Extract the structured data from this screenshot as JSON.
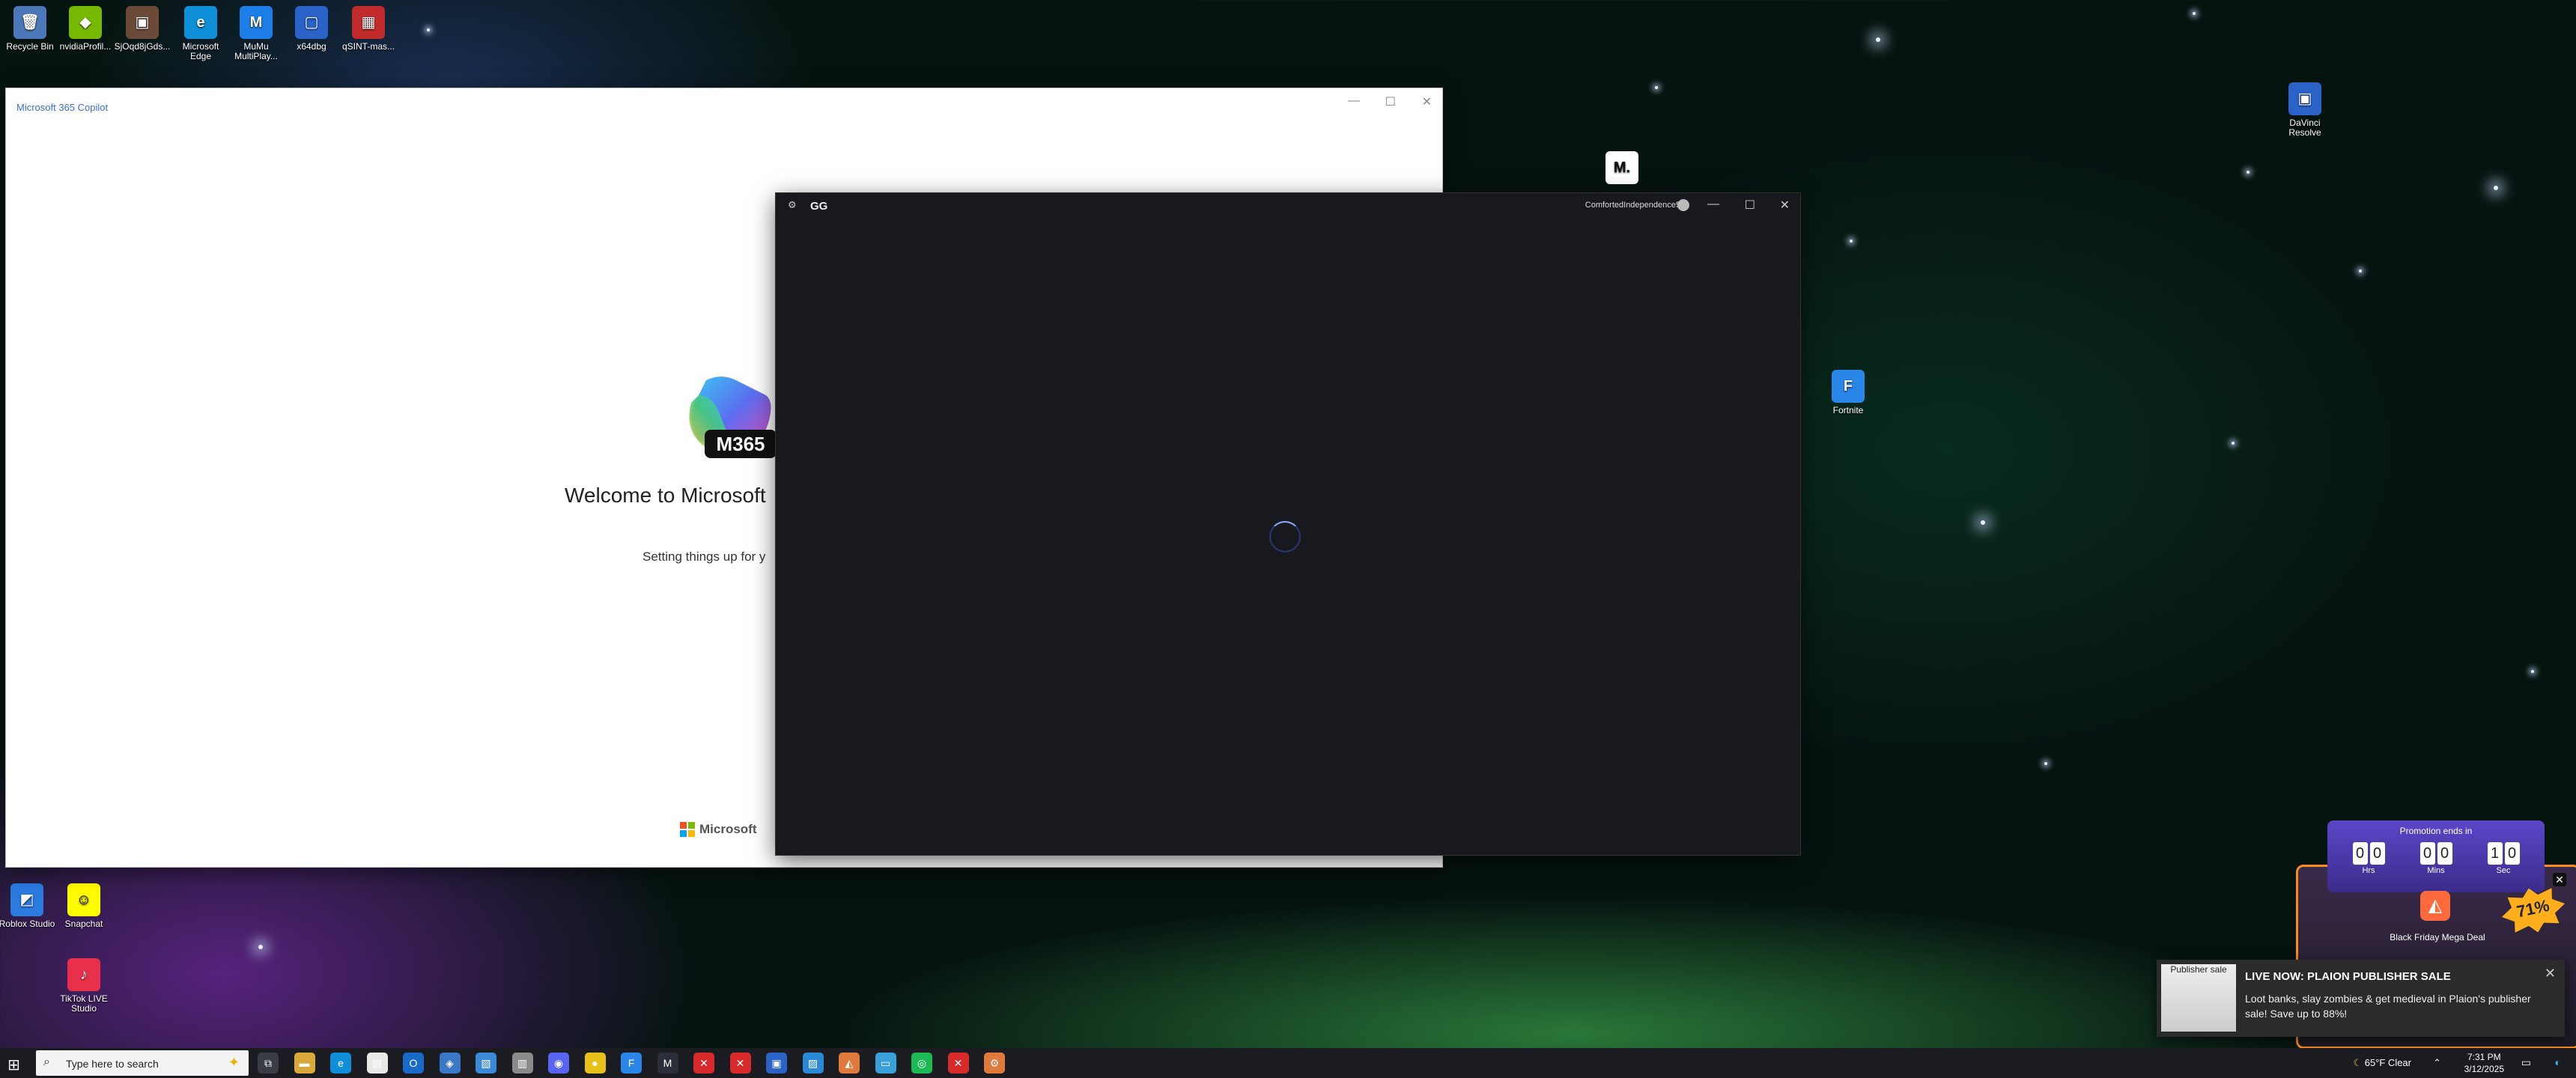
{
  "desktop_icons_top": [
    {
      "name": "recycle-bin-icon",
      "label": "Recycle Bin",
      "glyph": "🗑",
      "color": "#4a78b8"
    },
    {
      "name": "nvidia-icon",
      "label": "nvidiaProfil...",
      "glyph": "◆",
      "color": "#76b900"
    },
    {
      "name": "sjoq-icon",
      "label": "SjOqd8jGds...",
      "glyph": "▣",
      "color": "#6b4a3a"
    },
    {
      "name": "edge-icon",
      "label": "Microsoft Edge",
      "glyph": "e",
      "color": "#0f8fd8"
    },
    {
      "name": "mumu-icon",
      "label": "MuMu MultiPlay...",
      "glyph": "M",
      "color": "#1e7ee8"
    },
    {
      "name": "x64dbg-icon",
      "label": "x64dbg",
      "glyph": "▢",
      "color": "#2a62c8"
    },
    {
      "name": "qsint-icon",
      "label": "qSINT-mas...",
      "glyph": "▦",
      "color": "#c02a2a"
    }
  ],
  "desktop_icons_other": [
    {
      "name": "davinci-icon",
      "label": "DaVinci Resolve",
      "glyph": "▣",
      "color": "#2a62c8"
    },
    {
      "name": "m-app-icon",
      "label": "",
      "glyph": "M.",
      "color": "#ffffff"
    },
    {
      "name": "fortnite-icon",
      "label": "Fortnite",
      "glyph": "F",
      "color": "#2a86e8"
    },
    {
      "name": "roblox-icon",
      "label": "Roblox Studio",
      "glyph": "◩",
      "color": "#2a7ae0"
    },
    {
      "name": "snapchat-icon",
      "label": "Snapchat",
      "glyph": "☺",
      "color": "#fffc00"
    },
    {
      "name": "tiktok-icon",
      "label": "TikTok LIVE Studio",
      "glyph": "♪",
      "color": "#e8304a"
    }
  ],
  "m365_window": {
    "title": "Microsoft 365 Copilot",
    "logo_text": "M365",
    "welcome": "Welcome to Microsoft",
    "setup": "Setting things up for y",
    "brand": "Microsoft",
    "controls": {
      "min": "—",
      "max": "☐",
      "close": "✕"
    }
  },
  "gg_window": {
    "title": "GG",
    "username": "ComfortedIndependence5",
    "controls": {
      "min": "—",
      "max": "☐",
      "close": "✕"
    }
  },
  "promo": {
    "header": "Promotion ends in",
    "hrs": [
      "0",
      "0"
    ],
    "mins": [
      "0",
      "0"
    ],
    "secs": [
      "1",
      "0"
    ],
    "hrs_label": "Hrs",
    "mins_label": "Mins",
    "secs_label": "Sec",
    "badge": "71%",
    "deal": "Black Friday Mega Deal",
    "close": "✕"
  },
  "toast": {
    "image_text": "Publisher sale",
    "title": "LIVE NOW: PLAION PUBLISHER SALE",
    "body": "Loot banks, slay zombies & get medieval in Plaion's publisher sale! Save up to 88%!",
    "close": "✕"
  },
  "taskbar": {
    "search_placeholder": "Type here to search",
    "apps": [
      {
        "name": "task-view-icon",
        "glyph": "⧉",
        "color": "#3a3d45"
      },
      {
        "name": "file-explorer-icon",
        "glyph": "▬",
        "color": "#d8a838"
      },
      {
        "name": "edge-taskbar-icon",
        "glyph": "e",
        "color": "#0f8fd8"
      },
      {
        "name": "notepad-icon",
        "glyph": "▤",
        "color": "#e8e8e8"
      },
      {
        "name": "outlook-icon",
        "glyph": "O",
        "color": "#1a6bc8"
      },
      {
        "name": "app-blue-icon",
        "glyph": "◈",
        "color": "#3a78c8"
      },
      {
        "name": "app-photos-icon",
        "glyph": "▧",
        "color": "#3a8ad8"
      },
      {
        "name": "app-gray-icon",
        "glyph": "▥",
        "color": "#8a8a8a"
      },
      {
        "name": "discord-icon",
        "glyph": "◉",
        "color": "#5865f2"
      },
      {
        "name": "app-yellow-icon",
        "glyph": "●",
        "color": "#e8c21a"
      },
      {
        "name": "fortnite-taskbar-icon",
        "glyph": "F",
        "color": "#2a86e8"
      },
      {
        "name": "app-m-icon",
        "glyph": "M",
        "color": "#2b2f3a"
      },
      {
        "name": "app-red1-icon",
        "glyph": "✕",
        "color": "#d82a2a"
      },
      {
        "name": "app-red2-icon",
        "glyph": "✕",
        "color": "#d82a2a"
      },
      {
        "name": "app-box-icon",
        "glyph": "▣",
        "color": "#2a62c8"
      },
      {
        "name": "app-chart-icon",
        "glyph": "▨",
        "color": "#2a8ad8"
      },
      {
        "name": "app-orange-icon",
        "glyph": "◭",
        "color": "#e07a3c"
      },
      {
        "name": "app-folder-icon",
        "glyph": "▭",
        "color": "#3aa0d8"
      },
      {
        "name": "spotify-icon",
        "glyph": "◎",
        "color": "#1db954"
      },
      {
        "name": "app-red3-icon",
        "glyph": "✕",
        "color": "#d82a2a"
      },
      {
        "name": "gg-taskbar-icon",
        "glyph": "⚙",
        "color": "#2b2f3a"
      }
    ],
    "weather": "65°F  Clear",
    "time": "7:31 PM",
    "date": "3/12/2025"
  }
}
